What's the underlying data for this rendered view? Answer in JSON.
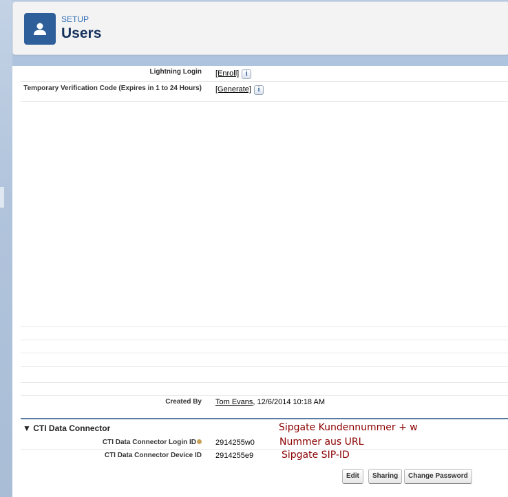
{
  "header": {
    "section": "SETUP",
    "title": "Users",
    "icon": "user-icon"
  },
  "fields": {
    "lightning_login": {
      "label": "Lightning Login",
      "link": "[Enroll]"
    },
    "temp_code": {
      "label": "Temporary Verification Code (Expires in 1 to 24 Hours)",
      "link": "[Generate]"
    },
    "created_by": {
      "label": "Created By",
      "user": "Tom Evans",
      "date": ", 12/6/2014 10:18 AM"
    }
  },
  "cti": {
    "section_title": "CTI Data Connector",
    "login_id_label": "CTI Data Connector Login ID",
    "login_id_value": "2914255w0",
    "device_id_label": "CTI Data Connector Device ID",
    "device_id_value": "2914255e9"
  },
  "annotations": {
    "line1": "Sipgate Kundennummer + w",
    "line2": "Nummer aus URL",
    "line3": "Sipgate SIP-ID"
  },
  "buttons": {
    "edit": "Edit",
    "sharing": "Sharing",
    "change_password": "Change Password"
  },
  "colors": {
    "brand": "#2f5f9a",
    "annotation": "#8b0000"
  }
}
